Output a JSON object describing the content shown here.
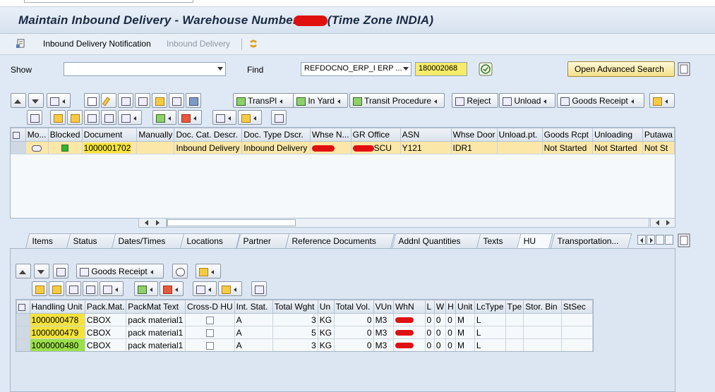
{
  "window": {
    "title_prefix": "Maintain Inbound Delivery - Warehouse Number",
    "title_suffix": "(Time Zone INDIA)"
  },
  "appbar": {
    "notification": "Inbound Delivery Notification",
    "delivery": "Inbound Delivery"
  },
  "search": {
    "show_label": "Show",
    "show_value": "",
    "find_label": "Find",
    "find_field": "REFDOCNO_ERP_I ERP ...",
    "find_value": "180002068",
    "advanced_search": "Open Advanced Search"
  },
  "toolbar1": {
    "transpl": "TransPl",
    "in_yard": "In Yard",
    "transit_procedure": "Transit Procedure",
    "reject": "Reject",
    "unload": "Unload",
    "goods_receipt": "Goods Receipt"
  },
  "grid1": {
    "columns": [
      "Mo...",
      "Blocked",
      "Document",
      "Manually",
      "Doc. Cat. Descr.",
      "Doc. Type Dscr.",
      "Whse N...",
      "GR Office",
      "ASN",
      "Whse Door",
      "Unload.pt.",
      "Goods Rcpt",
      "Unloading",
      "Putawa"
    ],
    "rows": [
      {
        "document": "1000001702",
        "manually": "",
        "doc_cat": "Inbound Delivery",
        "doc_type": "Inbound Delivery",
        "gr_office": "SCU",
        "asn": "Y121",
        "whse_door": "IDR1",
        "unload_pt": "",
        "goods_rcpt": "Not Started",
        "unloading": "Not Started",
        "putaway": "Not St"
      }
    ]
  },
  "tabs": [
    "Items",
    "Status",
    "Dates/Times",
    "Locations",
    "Partner",
    "Reference Documents",
    "Addnl Quantities",
    "Texts",
    "HU",
    "Transportation..."
  ],
  "toolbar2": {
    "goods_receipt": "Goods Receipt"
  },
  "grid2": {
    "columns": [
      "Handling Unit",
      "Pack.Mat.",
      "PackMat Text",
      "Cross-D HU",
      "Int. Stat.",
      "Total Wght",
      "Un",
      "Total Vol.",
      "VUn",
      "WhN",
      "L",
      "W",
      "H",
      "Unit",
      "LcType",
      "Tpe",
      "Stor. Bin",
      "StSec"
    ],
    "rows": [
      {
        "hu": "1000000478",
        "packmat": "CBOX",
        "text": "pack material1",
        "stat": "A",
        "weight": "3",
        "un": "KG",
        "vol": "0",
        "vun": "M3",
        "l": "0",
        "w": "0",
        "h": "0",
        "unit": "M",
        "lctype": "L"
      },
      {
        "hu": "1000000479",
        "packmat": "CBOX",
        "text": "pack material1",
        "stat": "A",
        "weight": "5",
        "un": "KG",
        "vol": "0",
        "vun": "M3",
        "l": "0",
        "w": "0",
        "h": "0",
        "unit": "M",
        "lctype": "L"
      },
      {
        "hu": "1000000480",
        "packmat": "CBOX",
        "text": "pack material1",
        "stat": "A",
        "weight": "3",
        "un": "KG",
        "vol": "0",
        "vun": "M3",
        "l": "0",
        "w": "0",
        "h": "0",
        "unit": "M",
        "lctype": "L"
      }
    ]
  },
  "colors": {
    "highlight_yellow": "#f5e33a",
    "highlight_green": "#9be04a",
    "redaction": "#e01010"
  }
}
